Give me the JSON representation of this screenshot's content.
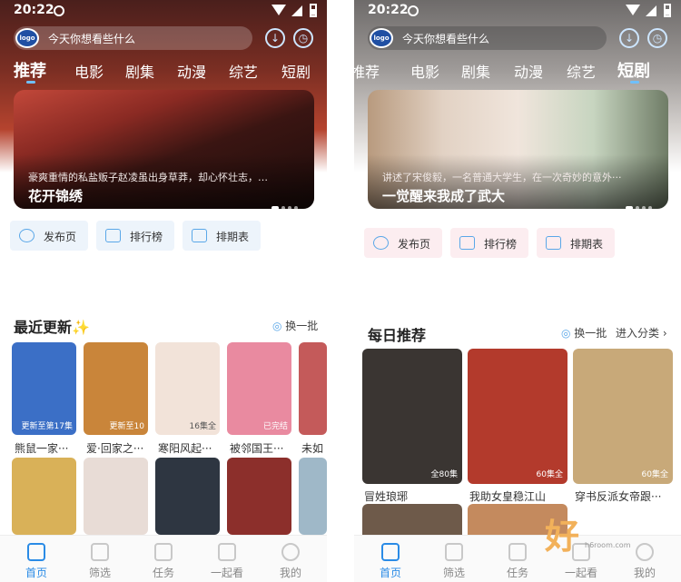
{
  "left": {
    "status": {
      "time": "20:22"
    },
    "search": {
      "placeholder": "今天你想看些什么",
      "logo": "logo"
    },
    "tabs": [
      {
        "label": "推荐",
        "active": true
      },
      {
        "label": "电影"
      },
      {
        "label": "剧集"
      },
      {
        "label": "动漫"
      },
      {
        "label": "综艺"
      },
      {
        "label": "短剧"
      }
    ],
    "banner": {
      "desc": "豪爽重情的私盐贩子赵凌虽出身草莽，却心怀壮志，…",
      "title": "花开锦绣"
    },
    "quick": [
      {
        "label": "发布页",
        "icon": "planet-icon"
      },
      {
        "label": "排行榜",
        "icon": "ranking-icon"
      },
      {
        "label": "排期表",
        "icon": "calendar-icon"
      }
    ],
    "section": {
      "title": "最近更新",
      "spark": "✨",
      "action": "换一批"
    },
    "cards": [
      {
        "name": "熊鼠一家···",
        "badge": "更新至第17集",
        "color": "#3b6fc6"
      },
      {
        "name": "爱·回家之···",
        "badge": "更新至10",
        "color": "#c9853a"
      },
      {
        "name": "寒阳风起···",
        "badge": "16集全",
        "color": "#f2e3d9"
      },
      {
        "name": "被邻国王···",
        "badge": "已完结",
        "color": "#e98aa0"
      },
      {
        "name": "未如",
        "badge": "",
        "color": "#c45a5a"
      }
    ],
    "cards_row2": [
      {
        "color": "#d9b158"
      },
      {
        "color": "#e8dcd6"
      },
      {
        "color": "#2e3641"
      },
      {
        "color": "#8c2f2b"
      },
      {
        "color": "#9fb8c8"
      }
    ],
    "nav": [
      {
        "label": "首页",
        "active": true
      },
      {
        "label": "筛选"
      },
      {
        "label": "任务"
      },
      {
        "label": "一起看"
      },
      {
        "label": "我的"
      }
    ]
  },
  "right": {
    "status": {
      "time": "20:22"
    },
    "search": {
      "placeholder": "今天你想看些什么",
      "logo": "logo"
    },
    "tabs": [
      {
        "label": "推荐"
      },
      {
        "label": "电影"
      },
      {
        "label": "剧集"
      },
      {
        "label": "动漫"
      },
      {
        "label": "综艺"
      },
      {
        "label": "短剧",
        "active": true
      }
    ],
    "banner": {
      "desc": "讲述了宋俊毅，一名普通大学生，在一次奇妙的意外···",
      "title": "一觉醒来我成了武大"
    },
    "quick": [
      {
        "label": "发布页",
        "icon": "planet-icon"
      },
      {
        "label": "排行榜",
        "icon": "ranking-icon"
      },
      {
        "label": "排期表",
        "icon": "calendar-icon"
      }
    ],
    "section": {
      "title": "每日推荐",
      "action": "换一批",
      "more": "进入分类 ›"
    },
    "cards": [
      {
        "name": "冒姓琅琊",
        "badge": "全80集",
        "color": "#3a3532"
      },
      {
        "name": "我助女皇稳江山",
        "badge": "60集全",
        "color": "#b33a2c"
      },
      {
        "name": "穿书反派女帝跟···",
        "badge": "60集全",
        "color": "#c8a979"
      }
    ],
    "cards_row2": [
      {
        "color": "#6e5a4a"
      },
      {
        "color": "#c48a5e"
      }
    ],
    "nav": [
      {
        "label": "首页",
        "active": true
      },
      {
        "label": "筛选"
      },
      {
        "label": "任务"
      },
      {
        "label": "一起看"
      },
      {
        "label": "我的"
      }
    ]
  },
  "watermark": {
    "text": "好",
    "sub": "h6room.com"
  }
}
